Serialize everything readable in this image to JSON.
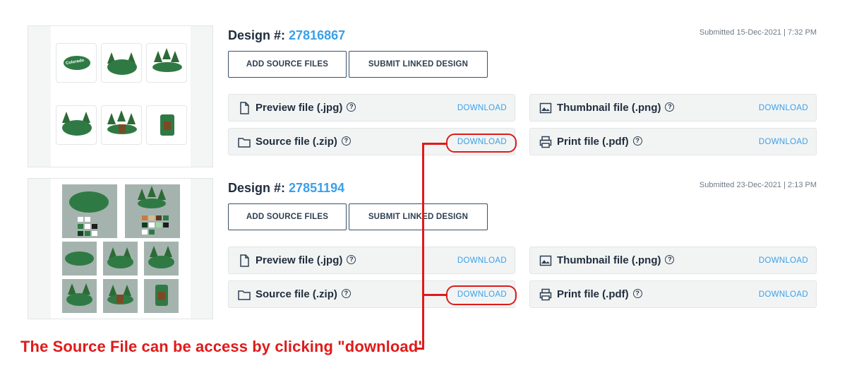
{
  "designs": [
    {
      "label": "Design #:",
      "number": "27816867",
      "submitted": "Submitted 15-Dec-2021 | 7:32 PM",
      "add_source_label": "ADD SOURCE FILES",
      "submit_linked_label": "SUBMIT LINKED DESIGN",
      "preview_label": "Preview file (.jpg)",
      "thumbnail_label": "Thumbnail file (.png)",
      "source_label": "Source file (.zip)",
      "print_label": "Print file (.pdf)",
      "download_label": "DOWNLOAD"
    },
    {
      "label": "Design #:",
      "number": "27851194",
      "submitted": "Submitted 23-Dec-2021 | 2:13 PM",
      "add_source_label": "ADD SOURCE FILES",
      "submit_linked_label": "SUBMIT LINKED DESIGN",
      "preview_label": "Preview file (.jpg)",
      "thumbnail_label": "Thumbnail file (.png)",
      "source_label": "Source file (.zip)",
      "print_label": "Print file (.pdf)",
      "download_label": "DOWNLOAD"
    }
  ],
  "annotation": {
    "caption": "The Source File can be access by clicking \"download\"",
    "color": "#e01a1a"
  },
  "icons": {
    "preview": "file-icon",
    "thumbnail": "image-icon",
    "source": "folder-icon",
    "print": "printer-icon",
    "help": "question-circle-icon"
  },
  "colors": {
    "accent": "#3aa0e8",
    "text": "#1f2d3d",
    "annotation": "#e01a1a"
  }
}
